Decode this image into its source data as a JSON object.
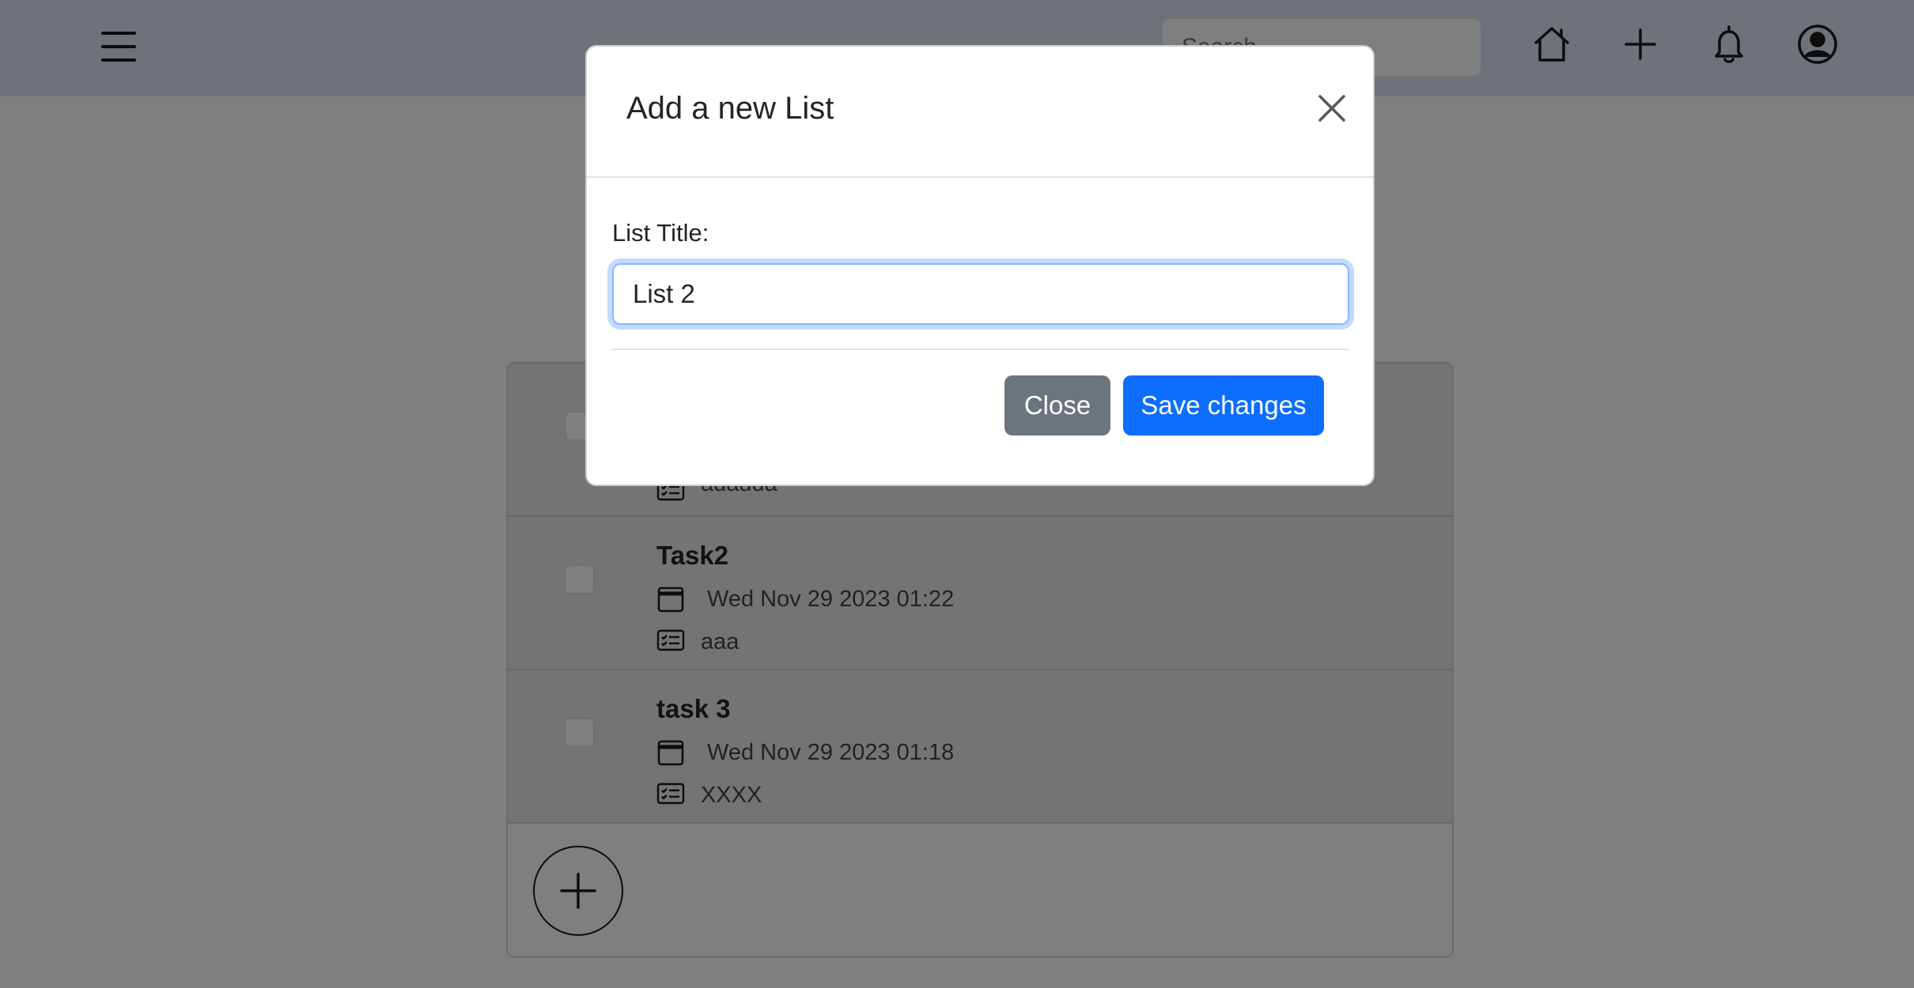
{
  "navbar": {
    "menu_icon": "hamburger-menu-icon",
    "search_placeholder": "Search",
    "icons": [
      "home-icon",
      "plus-icon",
      "bell-icon",
      "user-circle-icon"
    ]
  },
  "tasks": [
    {
      "title": "",
      "date": "",
      "note": "adadda"
    },
    {
      "title": "Task2",
      "date": "Wed Nov 29 2023 01:22",
      "note": "aaa"
    },
    {
      "title": "task 3",
      "date": "Wed Nov 29 2023 01:18",
      "note": "XXXX"
    }
  ],
  "add_task_icon": "plus-icon",
  "modal": {
    "title": "Add a new List",
    "field_label": "List Title:",
    "input_value": "List 2",
    "close_label": "Close",
    "save_label": "Save changes"
  },
  "colors": {
    "navbar_bg": "#dde7f5",
    "primary": "#0d6efd",
    "secondary": "#6c757d",
    "backdrop": "rgba(0,0,0,0.5)"
  }
}
